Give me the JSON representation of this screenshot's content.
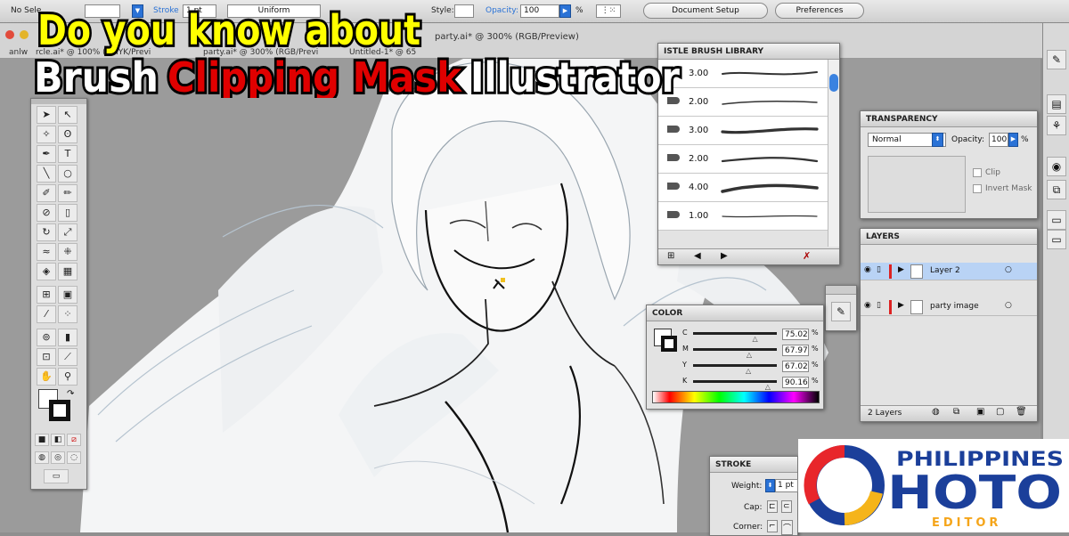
{
  "control_bar": {
    "no_selection": "No Sele",
    "stroke_label": "Stroke",
    "stroke_weight": "1 pt",
    "uniform": "Uniform",
    "style_label": "Style:",
    "opacity_label": "Opacity:",
    "opacity_value": "100",
    "percent": "%",
    "document_setup": "Document Setup",
    "preferences": "Preferences"
  },
  "doc_tabs": {
    "tab1": "party.ai* @ 300% (RGB/Preview)",
    "tab2": "anlw",
    "tab2b": "rcle.ai* @ 100% (CMYK/Previ",
    "tab3": "party.ai* @ 300% (RGB/Previ",
    "tab4": "Untitled-1* @ 65"
  },
  "title_overlay": {
    "line1": "Do you know about",
    "line2_a": "Brush",
    "line2_b": "Clipping Mask",
    "line2_c": "Illustrator"
  },
  "brush_panel": {
    "title": "ARTISTIC BRUSH LIBRARY",
    "title_visible": "ISTLE BRUSH LIBRARY",
    "rows": [
      {
        "value": "3.00"
      },
      {
        "value": "2.00"
      },
      {
        "value": "3.00"
      },
      {
        "value": "2.00"
      },
      {
        "value": "4.00"
      },
      {
        "value": "1.00"
      }
    ]
  },
  "transparency_panel": {
    "title": "TRANSPARENCY",
    "mode": "Normal",
    "opacity_label": "Opacity:",
    "opacity_value": "100",
    "percent": "%",
    "clip": "Clip",
    "invert_mask": "Invert Mask"
  },
  "color_panel": {
    "title": "COLOR",
    "channels": [
      {
        "name": "C",
        "value": "75.02",
        "level": 0.7502
      },
      {
        "name": "M",
        "value": "67.97",
        "level": 0.6797
      },
      {
        "name": "Y",
        "value": "67.02",
        "level": 0.6702
      },
      {
        "name": "K",
        "value": "90.16",
        "level": 0.9016
      }
    ],
    "percent": "%"
  },
  "layers_panel": {
    "title": "LAYERS",
    "layers": [
      {
        "name": "Layer 2"
      },
      {
        "name": "party image"
      }
    ],
    "count": "2 Layers"
  },
  "stroke_panel": {
    "title": "STROKE",
    "weight_label": "Weight:",
    "weight_value": "1 pt",
    "cap_label": "Cap:",
    "corner_label": "Corner:"
  },
  "logo": {
    "line1": "PHILIPPINES",
    "line2": "HOTO",
    "line3": "EDITOR"
  },
  "colors": {
    "accent_blue": "#2a72d6",
    "title_yellow": "#ffff00",
    "title_red": "#e00000",
    "layer_highlight": "#b9d3f5"
  }
}
